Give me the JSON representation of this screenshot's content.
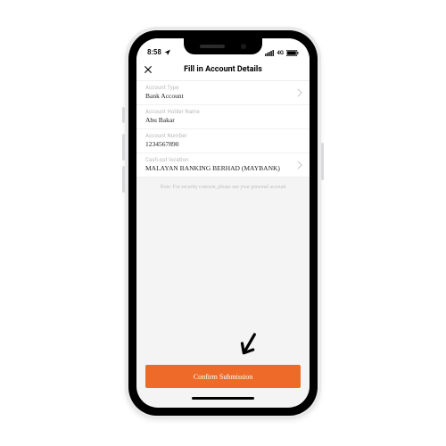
{
  "status": {
    "time": "8:58",
    "network": "4G"
  },
  "navbar": {
    "title": "Fill in Account Details"
  },
  "form": {
    "rows": [
      {
        "label": "Account Type",
        "value": "Bank Account",
        "chevron": true
      },
      {
        "label": "Account Holder Name",
        "value": "Abu Bakar",
        "chevron": false
      },
      {
        "label": "Account Number",
        "value": "1234567890",
        "chevron": false
      },
      {
        "label": "Cash-out location",
        "value": "MALAYAN BANKING BERHAD (MAYBANK)",
        "chevron": true
      }
    ],
    "note": "Note: For security concern, please use your personal account"
  },
  "cta": {
    "label": "Confirm Submission"
  },
  "colors": {
    "accent": "#ee6a28"
  }
}
